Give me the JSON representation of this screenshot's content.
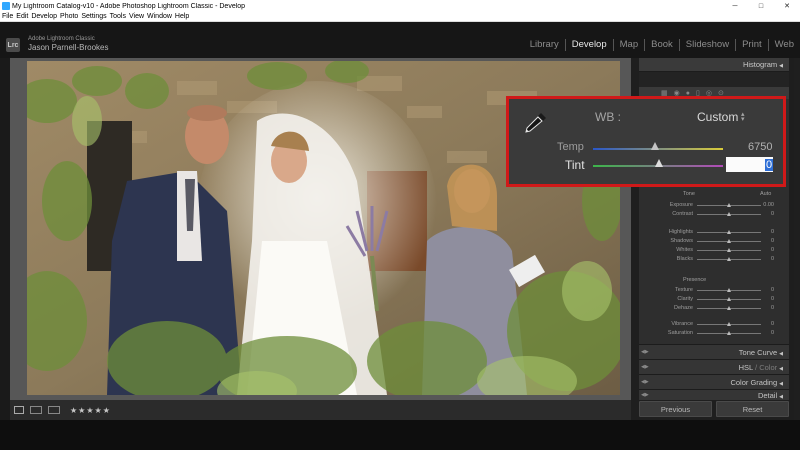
{
  "window": {
    "title": "My Lightroom Catalog-v10 - Adobe Photoshop Lightroom Classic - Develop",
    "minimize": "─",
    "maximize": "□",
    "close": "✕"
  },
  "menu": [
    "File",
    "Edit",
    "Develop",
    "Photo",
    "Settings",
    "Tools",
    "View",
    "Window",
    "Help"
  ],
  "identity": {
    "logo": "Lrc",
    "product": "Adobe Lightroom Classic",
    "user": "Jason Parnell-Brookes"
  },
  "modules": [
    "Library",
    "Develop",
    "Map",
    "Book",
    "Slideshow",
    "Print",
    "Web"
  ],
  "active_module": "Develop",
  "panel": {
    "histogram": "Histogram",
    "tone_label": "Tone",
    "tone_auto": "Auto",
    "tone_sliders": [
      {
        "label": "Exposure",
        "value": "0.00",
        "pos": 0.5
      },
      {
        "label": "Contrast",
        "value": "0",
        "pos": 0.5
      }
    ],
    "tone2_sliders": [
      {
        "label": "Highlights",
        "value": "0",
        "pos": 0.5
      },
      {
        "label": "Shadows",
        "value": "0",
        "pos": 0.5
      },
      {
        "label": "Whites",
        "value": "0",
        "pos": 0.5
      },
      {
        "label": "Blacks",
        "value": "0",
        "pos": 0.5
      }
    ],
    "presence_label": "Presence",
    "presence_sliders": [
      {
        "label": "Texture",
        "value": "0",
        "pos": 0.5
      },
      {
        "label": "Clarity",
        "value": "0",
        "pos": 0.5
      },
      {
        "label": "Dehaze",
        "value": "0",
        "pos": 0.5
      }
    ],
    "color_sliders": [
      {
        "label": "Vibrance",
        "value": "0",
        "pos": 0.5
      },
      {
        "label": "Saturation",
        "value": "0",
        "pos": 0.5
      }
    ],
    "tone_curve": "Tone Curve",
    "hsl": "HSL",
    "hsl_sep": " / ",
    "hsl_color": "Color",
    "color_grading": "Color Grading",
    "detail": "Detail"
  },
  "callout": {
    "wb_label": "WB :",
    "wb_value": "Custom",
    "temp_label": "Temp",
    "temp_value": "6750",
    "temp_pos": 0.45,
    "tint_label": "Tint",
    "tint_value": "0",
    "tint_pos": 0.5
  },
  "buttons": {
    "previous": "Previous",
    "reset": "Reset"
  },
  "toolbar": {
    "stars": "★★★★★"
  },
  "colors": {
    "callout_border": "#d01919",
    "selection": "#2f6fd6"
  }
}
